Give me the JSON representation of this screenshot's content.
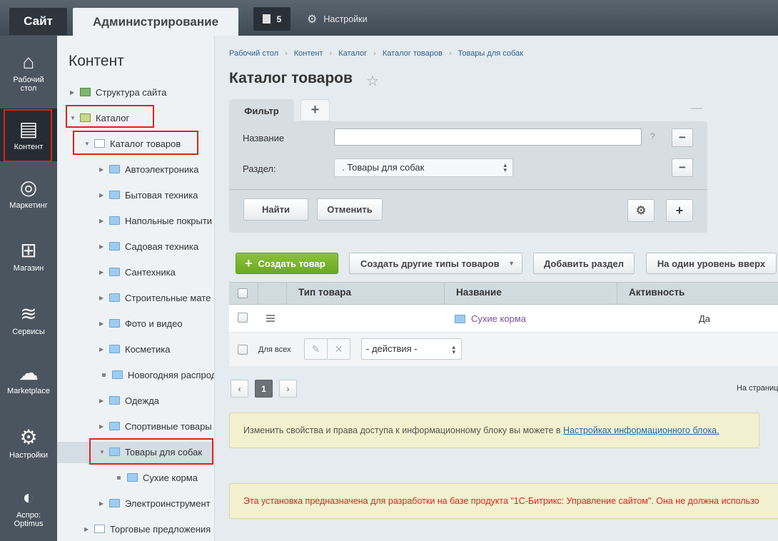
{
  "topbar": {
    "site_tab": "Сайт",
    "admin_tab": "Администрирование",
    "notifications_count": "5",
    "settings_label": "Настройки"
  },
  "leftnav": [
    {
      "label": "Рабочий стол",
      "icon": "home-icon"
    },
    {
      "label": "Контент",
      "icon": "document-icon",
      "active": true
    },
    {
      "label": "Маркетинг",
      "icon": "target-icon"
    },
    {
      "label": "Магазин",
      "icon": "basket-icon"
    },
    {
      "label": "Сервисы",
      "icon": "layers-icon"
    },
    {
      "label": "Marketplace",
      "icon": "cloud-download-icon"
    },
    {
      "label": "Настройки",
      "icon": "gear-icon"
    },
    {
      "label": "Аспро: Optimus",
      "icon": "aspro-logo-icon"
    }
  ],
  "tree": {
    "title": "Контент",
    "items": [
      {
        "label": "Структура сайта"
      },
      {
        "label": "Каталог"
      },
      {
        "label": "Каталог товаров"
      },
      {
        "label": "Автоэлектроника"
      },
      {
        "label": "Бытовая техника"
      },
      {
        "label": "Напольные покрыти"
      },
      {
        "label": "Садовая техника"
      },
      {
        "label": "Сантехника"
      },
      {
        "label": "Строительные мате"
      },
      {
        "label": "Фото и видео"
      },
      {
        "label": "Косметика"
      },
      {
        "label": "Новогодняя распрод"
      },
      {
        "label": "Одежда"
      },
      {
        "label": "Спортивные товары"
      },
      {
        "label": "Товары для собак"
      },
      {
        "label": "Сухие корма"
      },
      {
        "label": "Электроинструмент"
      },
      {
        "label": "Торговые предложения"
      }
    ]
  },
  "breadcrumbs": [
    "Рабочий стол",
    "Каталог товаров",
    "Товары для собак"
  ],
  "breadcrumb_extra": [
    "Контент",
    "Каталог"
  ],
  "page_title": "Каталог товаров",
  "filter": {
    "tab_label": "Фильтр",
    "name_label": "Название",
    "name_value": "",
    "help": "?",
    "section_label": "Раздел:",
    "section_value": ". Товары для собак",
    "find_button": "Найти",
    "cancel_button": "Отменить"
  },
  "toolbar": {
    "create_button": "Создать товар",
    "other_types_button": "Создать другие типы товаров",
    "add_section_button": "Добавить раздел",
    "up_level_button": "На один уровень вверх"
  },
  "grid": {
    "columns": [
      "Тип товара",
      "Название",
      "Активность"
    ],
    "rows": [
      {
        "type": "",
        "name": "Сухие корма",
        "active": "Да"
      }
    ],
    "for_all_label": "Для всех",
    "actions_select": "- действия -"
  },
  "pagination": {
    "current_page": "1",
    "per_page_label": "На страниц"
  },
  "notices": {
    "info_text": "Изменить свойства и права доступа к информационному блоку вы можете в ",
    "info_link": "Настройках информационного блока.",
    "warning_text": "Эта установка предназначена для разработки на базе продукта \"1С-Битрикс: Управление сайтом\". Она не должна использо"
  },
  "colors": {
    "highlight_box": "#d9251d",
    "create_button": "#7ab52e",
    "leftnav_bg": "#4b5560"
  }
}
